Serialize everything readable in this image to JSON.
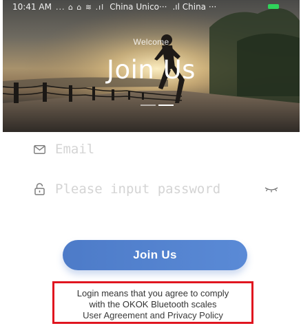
{
  "status_bar": {
    "time": "10:41 AM",
    "glyphs": "... ⌂ ⌂ ≋ .ıl",
    "carrier_1": "China Unico···",
    "carrier_2": ".ıl China ···"
  },
  "hero": {
    "welcome": "Welcome",
    "title": "Join Us",
    "slides_total": 2,
    "slide_active": 2
  },
  "form": {
    "email": {
      "placeholder": "Email",
      "value": "",
      "icon": "envelope-icon"
    },
    "password": {
      "placeholder": "Please input password",
      "value": "",
      "icon": "lock-icon",
      "toggle_icon": "eye-closed-icon"
    }
  },
  "join_button": {
    "label": "Join Us"
  },
  "agreement": {
    "line1": "Login means that you agree to comply",
    "line2": "with the OKOK Bluetooth scales",
    "line3": "User Agreement and Privacy Policy",
    "highlight_color": "#e0151f"
  },
  "colors": {
    "accent": "#4d7bc8",
    "placeholder": "#d4d4d4",
    "battery": "#2fd35a"
  }
}
